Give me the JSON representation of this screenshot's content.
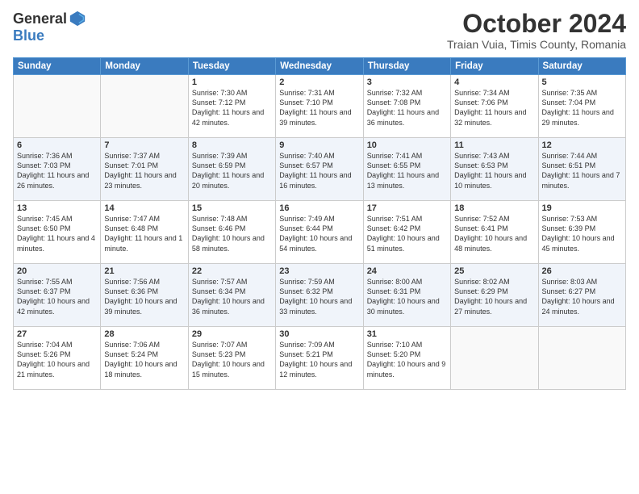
{
  "logo": {
    "general": "General",
    "blue": "Blue"
  },
  "header": {
    "title": "October 2024",
    "subtitle": "Traian Vuia, Timis County, Romania"
  },
  "weekdays": [
    "Sunday",
    "Monday",
    "Tuesday",
    "Wednesday",
    "Thursday",
    "Friday",
    "Saturday"
  ],
  "weeks": [
    [
      {
        "day": "",
        "info": ""
      },
      {
        "day": "",
        "info": ""
      },
      {
        "day": "1",
        "info": "Sunrise: 7:30 AM\nSunset: 7:12 PM\nDaylight: 11 hours and 42 minutes."
      },
      {
        "day": "2",
        "info": "Sunrise: 7:31 AM\nSunset: 7:10 PM\nDaylight: 11 hours and 39 minutes."
      },
      {
        "day": "3",
        "info": "Sunrise: 7:32 AM\nSunset: 7:08 PM\nDaylight: 11 hours and 36 minutes."
      },
      {
        "day": "4",
        "info": "Sunrise: 7:34 AM\nSunset: 7:06 PM\nDaylight: 11 hours and 32 minutes."
      },
      {
        "day": "5",
        "info": "Sunrise: 7:35 AM\nSunset: 7:04 PM\nDaylight: 11 hours and 29 minutes."
      }
    ],
    [
      {
        "day": "6",
        "info": "Sunrise: 7:36 AM\nSunset: 7:03 PM\nDaylight: 11 hours and 26 minutes."
      },
      {
        "day": "7",
        "info": "Sunrise: 7:37 AM\nSunset: 7:01 PM\nDaylight: 11 hours and 23 minutes."
      },
      {
        "day": "8",
        "info": "Sunrise: 7:39 AM\nSunset: 6:59 PM\nDaylight: 11 hours and 20 minutes."
      },
      {
        "day": "9",
        "info": "Sunrise: 7:40 AM\nSunset: 6:57 PM\nDaylight: 11 hours and 16 minutes."
      },
      {
        "day": "10",
        "info": "Sunrise: 7:41 AM\nSunset: 6:55 PM\nDaylight: 11 hours and 13 minutes."
      },
      {
        "day": "11",
        "info": "Sunrise: 7:43 AM\nSunset: 6:53 PM\nDaylight: 11 hours and 10 minutes."
      },
      {
        "day": "12",
        "info": "Sunrise: 7:44 AM\nSunset: 6:51 PM\nDaylight: 11 hours and 7 minutes."
      }
    ],
    [
      {
        "day": "13",
        "info": "Sunrise: 7:45 AM\nSunset: 6:50 PM\nDaylight: 11 hours and 4 minutes."
      },
      {
        "day": "14",
        "info": "Sunrise: 7:47 AM\nSunset: 6:48 PM\nDaylight: 11 hours and 1 minute."
      },
      {
        "day": "15",
        "info": "Sunrise: 7:48 AM\nSunset: 6:46 PM\nDaylight: 10 hours and 58 minutes."
      },
      {
        "day": "16",
        "info": "Sunrise: 7:49 AM\nSunset: 6:44 PM\nDaylight: 10 hours and 54 minutes."
      },
      {
        "day": "17",
        "info": "Sunrise: 7:51 AM\nSunset: 6:42 PM\nDaylight: 10 hours and 51 minutes."
      },
      {
        "day": "18",
        "info": "Sunrise: 7:52 AM\nSunset: 6:41 PM\nDaylight: 10 hours and 48 minutes."
      },
      {
        "day": "19",
        "info": "Sunrise: 7:53 AM\nSunset: 6:39 PM\nDaylight: 10 hours and 45 minutes."
      }
    ],
    [
      {
        "day": "20",
        "info": "Sunrise: 7:55 AM\nSunset: 6:37 PM\nDaylight: 10 hours and 42 minutes."
      },
      {
        "day": "21",
        "info": "Sunrise: 7:56 AM\nSunset: 6:36 PM\nDaylight: 10 hours and 39 minutes."
      },
      {
        "day": "22",
        "info": "Sunrise: 7:57 AM\nSunset: 6:34 PM\nDaylight: 10 hours and 36 minutes."
      },
      {
        "day": "23",
        "info": "Sunrise: 7:59 AM\nSunset: 6:32 PM\nDaylight: 10 hours and 33 minutes."
      },
      {
        "day": "24",
        "info": "Sunrise: 8:00 AM\nSunset: 6:31 PM\nDaylight: 10 hours and 30 minutes."
      },
      {
        "day": "25",
        "info": "Sunrise: 8:02 AM\nSunset: 6:29 PM\nDaylight: 10 hours and 27 minutes."
      },
      {
        "day": "26",
        "info": "Sunrise: 8:03 AM\nSunset: 6:27 PM\nDaylight: 10 hours and 24 minutes."
      }
    ],
    [
      {
        "day": "27",
        "info": "Sunrise: 7:04 AM\nSunset: 5:26 PM\nDaylight: 10 hours and 21 minutes."
      },
      {
        "day": "28",
        "info": "Sunrise: 7:06 AM\nSunset: 5:24 PM\nDaylight: 10 hours and 18 minutes."
      },
      {
        "day": "29",
        "info": "Sunrise: 7:07 AM\nSunset: 5:23 PM\nDaylight: 10 hours and 15 minutes."
      },
      {
        "day": "30",
        "info": "Sunrise: 7:09 AM\nSunset: 5:21 PM\nDaylight: 10 hours and 12 minutes."
      },
      {
        "day": "31",
        "info": "Sunrise: 7:10 AM\nSunset: 5:20 PM\nDaylight: 10 hours and 9 minutes."
      },
      {
        "day": "",
        "info": ""
      },
      {
        "day": "",
        "info": ""
      }
    ]
  ]
}
